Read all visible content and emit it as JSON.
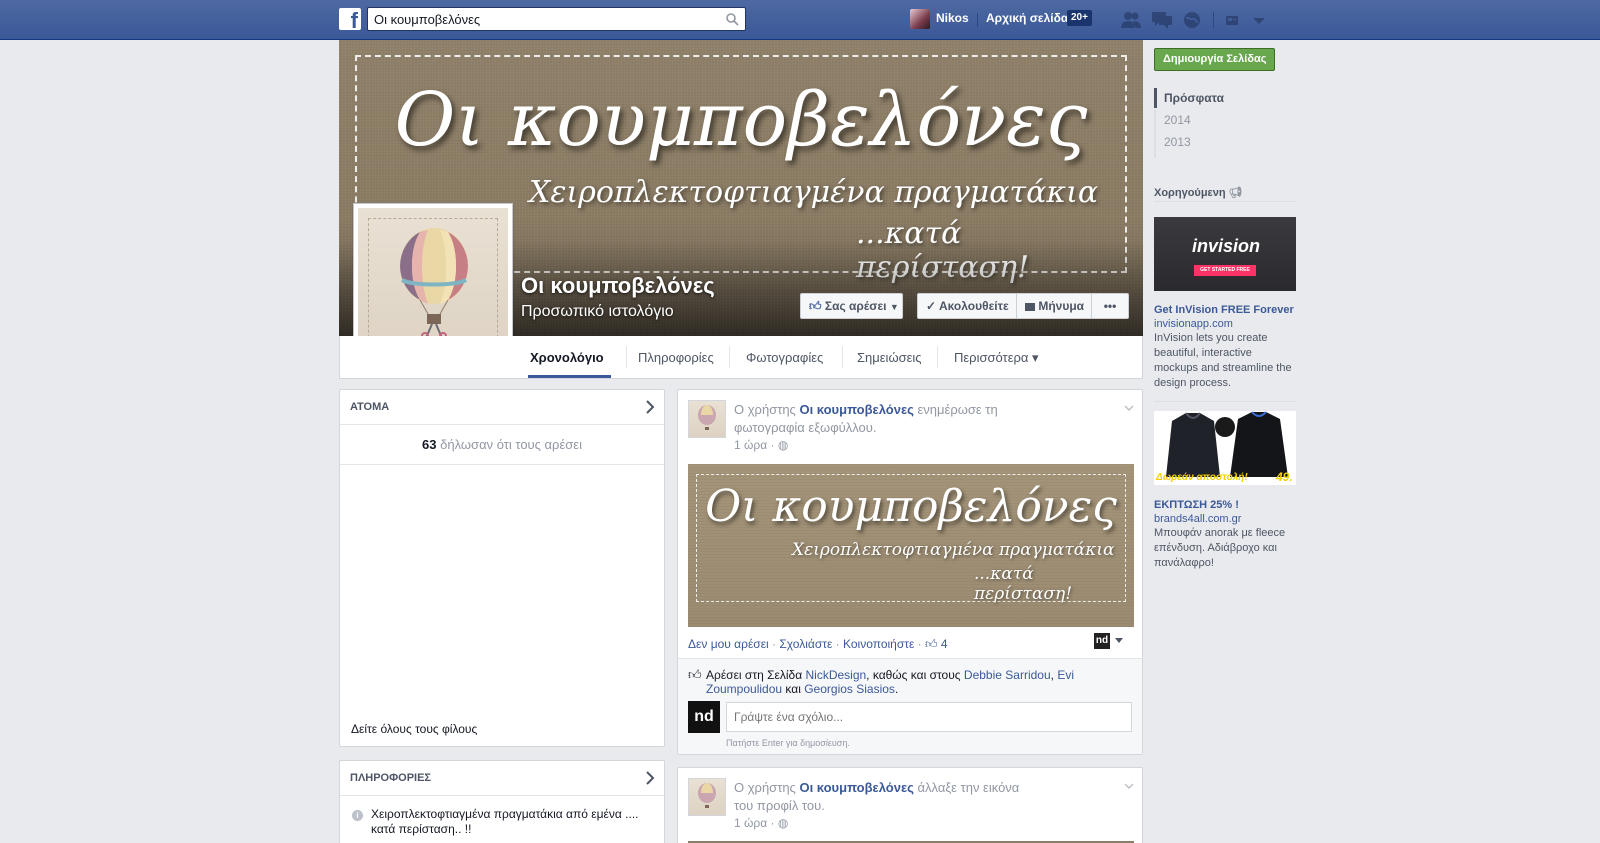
{
  "topbar": {
    "search_value": "Οι κουμποβελόνες",
    "user_name": "Nikos",
    "home_label": "Αρχική σελίδα",
    "home_badge": "20+",
    "icons": [
      "friend-requests-icon",
      "messages-icon",
      "notifications-icon",
      "privacy-icon",
      "account-menu-icon"
    ]
  },
  "cover": {
    "title": "Οι κουμποβελόνες",
    "subtitle_line1": "Χειροπλεκτοφτιαγμένα πραγματάκια",
    "subtitle_line2": "...κατά περίσταση!"
  },
  "page": {
    "name": "Οι κουμποβελόνες",
    "category": "Προσωπικό ιστολόγιο",
    "buttons": {
      "like": "Σας αρέσει",
      "follow": "Ακολουθείτε",
      "message": "Μήνυμα",
      "more": "•••"
    }
  },
  "tabs": [
    {
      "label": "Χρονολόγιο",
      "active": true
    },
    {
      "label": "Πληροφορίες"
    },
    {
      "label": "Φωτογραφίες"
    },
    {
      "label": "Σημειώσεις"
    },
    {
      "label": "Περισσότερα ▾"
    }
  ],
  "people_box": {
    "header": "ΑΤΟΜΑ",
    "likes_count": "63",
    "likes_text": "δήλωσαν ότι τους αρέσει",
    "see_all": "Δείτε όλους τους φίλους"
  },
  "about_box": {
    "header": "ΠΛΗΡΟΦΟΡΙΕΣ",
    "description": "Χειροπλεκτοφτιαγμένα πραγματάκια από εμένα .... κατά περίσταση.. !!"
  },
  "posts": [
    {
      "prefix": "Ο χρήστης",
      "author": "Οι κουμποβελόνες",
      "action": "ενημέρωσε τη φωτογραφία εξωφύλλου.",
      "time": "1 ώρα",
      "image": {
        "title": "Οι κουμποβελόνες",
        "subtitle_line1": "Χειροπλεκτοφτιαγμένα πραγματάκια",
        "subtitle_line2": "...κατά περίσταση!"
      },
      "actions": {
        "unlike": "Δεν μου αρέσει",
        "comment": "Σχολιάστε",
        "share": "Κοινοποιήστε",
        "like_count": "4"
      },
      "likes_line": {
        "prefix": "Αρέσει στη Σελίδα",
        "page": "NickDesign",
        "mid": ", καθώς και στους",
        "person1": "Debbie Sarridou",
        "person2": "Evi Zoumpoulidou",
        "and": "και",
        "person3": "Georgios Siasios"
      },
      "comment_placeholder": "Γράψτε ένα σχόλιο...",
      "comment_hint": "Πατήστε Enter για δημοσίευση.",
      "commenter_logo": "nd"
    },
    {
      "prefix": "Ο χρήστης",
      "author": "Οι κουμποβελόνες",
      "action": "άλλαξε την εικόνα του προφίλ του.",
      "time": "1 ώρα"
    }
  ],
  "right": {
    "create_page": "Δημιουργία Σελίδας",
    "years": [
      "Πρόσφατα",
      "2014",
      "2013"
    ],
    "sponsored": "Χορηγούμενη",
    "ads": [
      {
        "image_logo": "invision",
        "image_cta": "GET STARTED FREE",
        "title": "Get InVision FREE Forever",
        "domain": "invisionapp.com",
        "text": "InVision lets you create beautiful, interactive mockups and streamline the design process."
      },
      {
        "image_caption": "Δωρεάν αποστολή!",
        "image_price": "49.",
        "title": "ΕΚΠΤΩΣΗ 25% !",
        "domain": "brands4all.com.gr",
        "text": "Μπουφάν anorak με fleece επένδυση. Αδιάβροχο και πανάλαφρο!"
      }
    ]
  },
  "colors": {
    "fb_blue": "#3b5998",
    "create_green": "#69a74e",
    "background": "#e9eaed"
  }
}
